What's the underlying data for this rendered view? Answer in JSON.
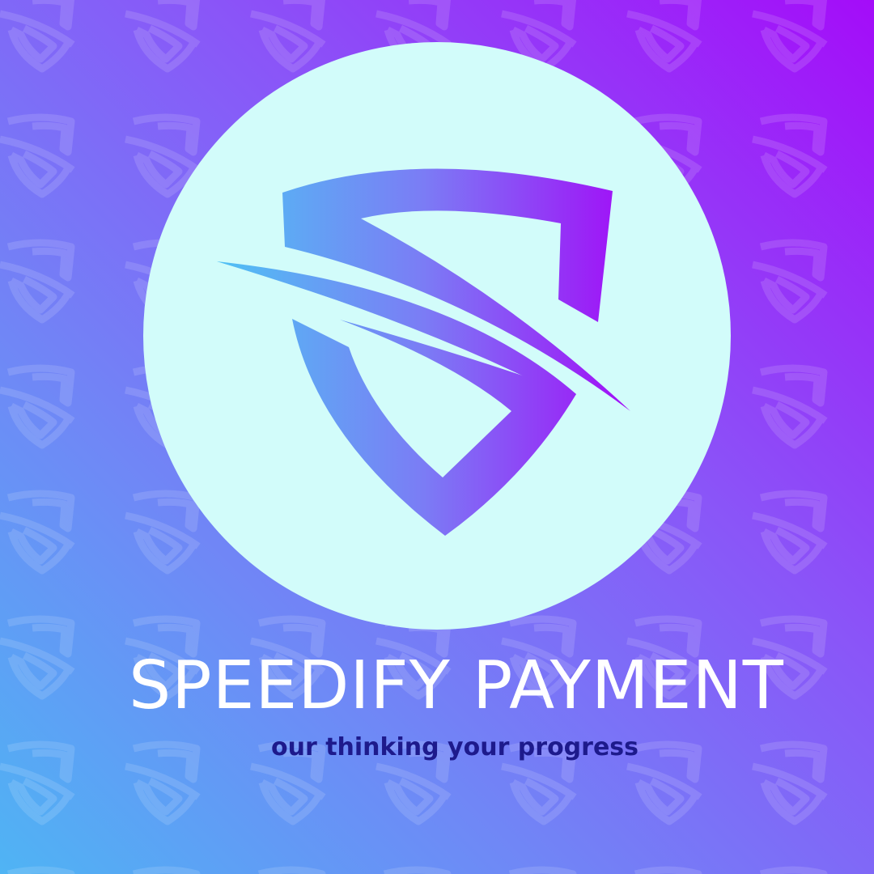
{
  "brand": {
    "name": "SPEEDIFY PAYMENT",
    "tagline": "our thinking your progress"
  },
  "logo": {
    "icon": "shield-s-swoosh-icon",
    "description": ""
  },
  "colors": {
    "background_start": "#4fb4f4",
    "background_end": "#a40cf9",
    "circle": "#d2fcfa",
    "logo_gradient_start": "#4fc1f4",
    "logo_gradient_end": "#a20cf7",
    "title": "#ffffff",
    "tagline": "#1d1a8c"
  }
}
